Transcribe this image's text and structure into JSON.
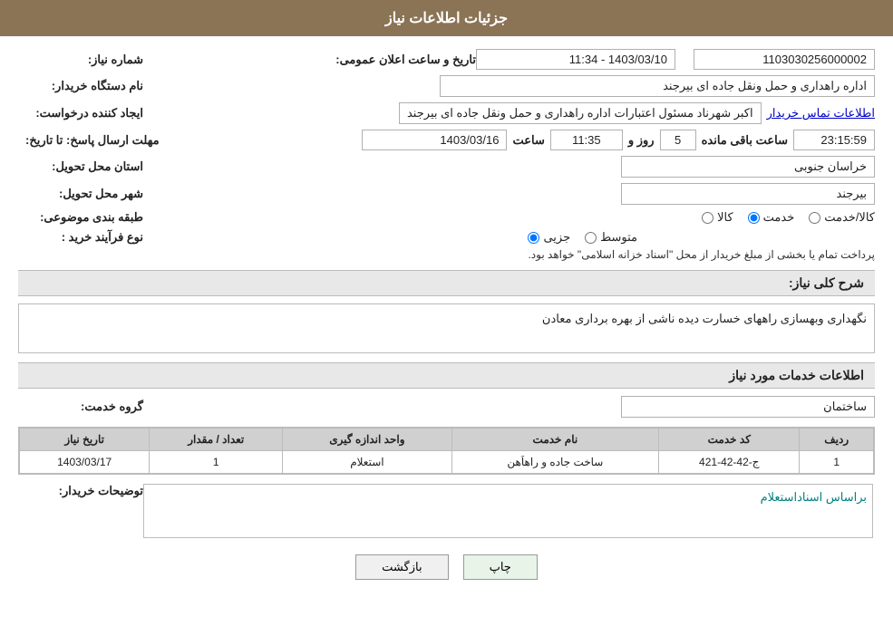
{
  "header": {
    "title": "جزئیات اطلاعات نیاز"
  },
  "fields": {
    "need_number_label": "شماره نیاز:",
    "need_number_value": "1103030256000002",
    "date_label": "تاریخ و ساعت اعلان عمومی:",
    "date_value": "1403/03/10 - 11:34",
    "buyer_org_label": "نام دستگاه خریدار:",
    "buyer_org_value": "اداره راهداری و حمل ونقل جاده ای بیرجند",
    "requester_label": "ایجاد کننده درخواست:",
    "requester_value": "اکبر شهرناد مسئول اعتبارات اداره راهداری و حمل ونقل جاده ای بیرجند",
    "contact_link": "اطلاعات تماس خریدار",
    "response_deadline_label": "مهلت ارسال پاسخ: تا تاریخ:",
    "response_date": "1403/03/16",
    "response_time_label": "ساعت",
    "response_time": "11:35",
    "response_day_label": "روز و",
    "response_days": "5",
    "response_remaining_label": "ساعت باقی مانده",
    "response_remaining": "23:15:59",
    "province_label": "استان محل تحویل:",
    "province_value": "خراسان جنوبی",
    "city_label": "شهر محل تحویل:",
    "city_value": "بیرجند",
    "category_label": "طبقه بندی موضوعی:",
    "category_options": [
      "کالا",
      "خدمت",
      "کالا/خدمت"
    ],
    "category_selected": "خدمت",
    "purchase_type_label": "نوع فرآیند خرید :",
    "purchase_type_options": [
      "جزیی",
      "متوسط"
    ],
    "purchase_type_note": "پرداخت تمام یا بخشی از مبلغ خریدار از محل \"اسناد خزانه اسلامی\" خواهد بود.",
    "need_description_label": "شرح کلی نیاز:",
    "need_description_value": "نگهداری وبهسازی راههای خسارت دیده ناشی از بهره برداری معادن",
    "services_title": "اطلاعات خدمات مورد نیاز",
    "service_group_label": "گروه خدمت:",
    "service_group_value": "ساختمان",
    "table": {
      "headers": [
        "ردیف",
        "کد خدمت",
        "نام خدمت",
        "واحد اندازه گیری",
        "تعداد / مقدار",
        "تاریخ نیاز"
      ],
      "rows": [
        {
          "row": "1",
          "code": "ج-42-42-421",
          "name": "ساخت جاده و راهاَهن",
          "unit": "استعلام",
          "qty": "1",
          "date": "1403/03/17"
        }
      ]
    },
    "buyer_desc_label": "توضیحات خریدار:",
    "buyer_desc_value": "براساس اسناداستعلام"
  },
  "buttons": {
    "print": "چاپ",
    "back": "بازگشت"
  }
}
